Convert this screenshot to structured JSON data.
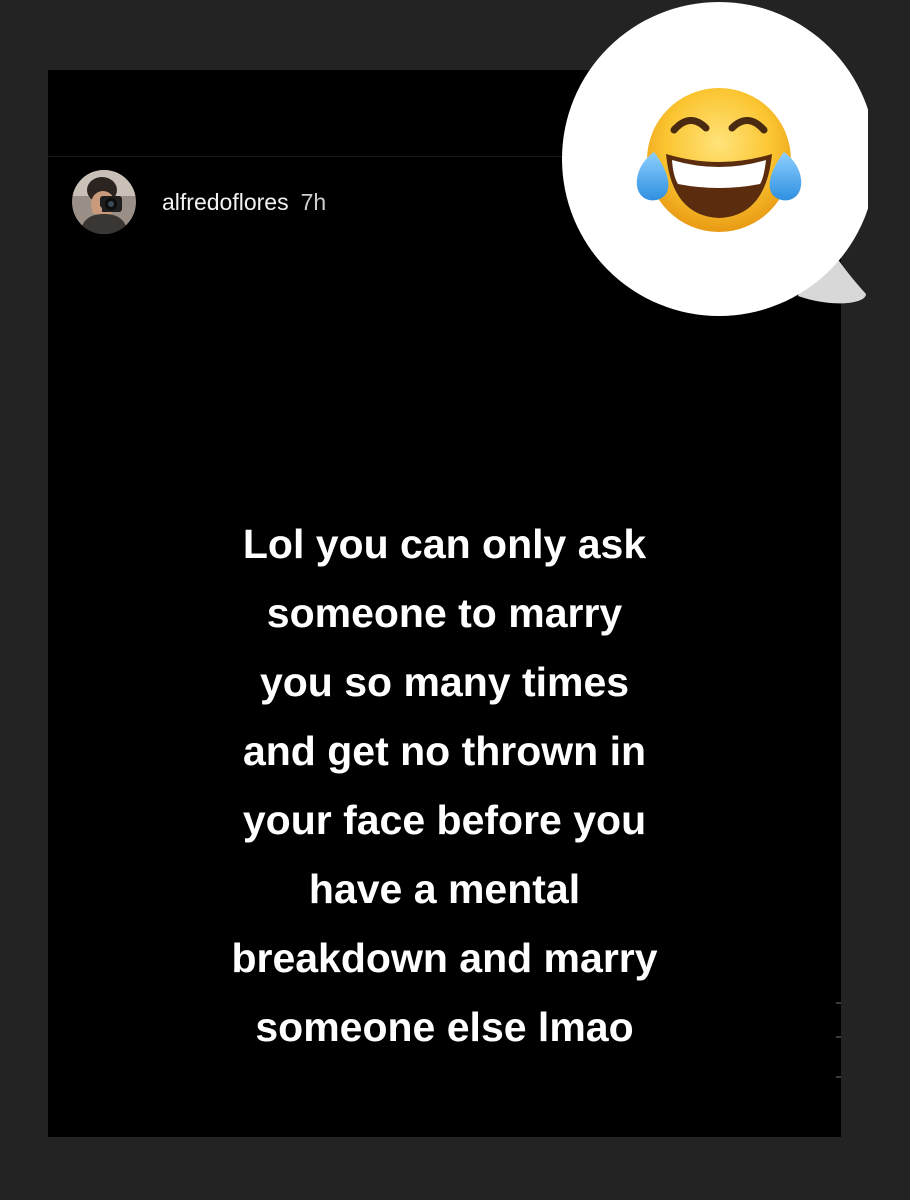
{
  "story": {
    "username": "alfredoflores",
    "time": "7h",
    "caption_lines": [
      "Lol you can only ask",
      "someone to marry",
      "you so many times",
      "and get no thrown in",
      "your face before you",
      "have a mental",
      "breakdown and marry",
      "someone else lmao"
    ]
  },
  "reaction": {
    "emoji": "face-with-tears-of-joy"
  },
  "colors": {
    "page_background": "#232323",
    "story_background": "#000000",
    "text": "#ffffff",
    "bubble": "#ffffff"
  }
}
